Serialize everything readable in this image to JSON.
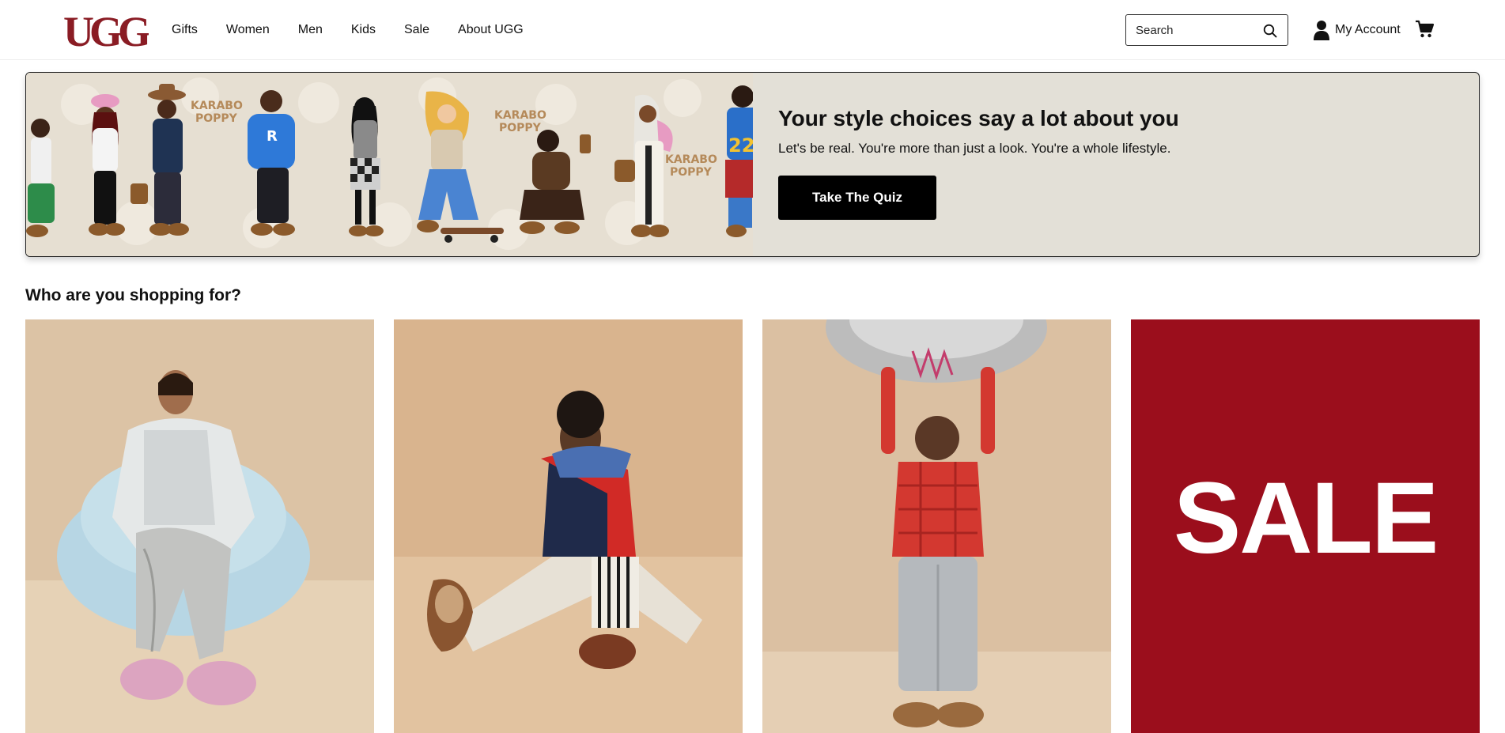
{
  "brand": {
    "logo_text": "UGG",
    "color": "#8a1c24"
  },
  "nav": {
    "items": [
      {
        "label": "Gifts"
      },
      {
        "label": "Women"
      },
      {
        "label": "Men"
      },
      {
        "label": "Kids"
      },
      {
        "label": "Sale"
      },
      {
        "label": "About UGG"
      }
    ]
  },
  "search": {
    "placeholder": "Search",
    "icon": "search-icon"
  },
  "account": {
    "label": "My Account",
    "icon": "user-icon"
  },
  "cart": {
    "icon": "cart-icon"
  },
  "banner": {
    "title": "Your style choices say a lot about you",
    "subtitle": "Let's be real. You're more than just a look. You're a whole lifestyle.",
    "button_label": "Take The Quiz",
    "art_lettering": [
      "KARABO",
      "POPPY"
    ],
    "background_color": "#e3e0d7"
  },
  "shopping": {
    "heading": "Who are you shopping for?",
    "tiles": [
      {
        "category": "women",
        "image": "woman-in-silver-outfit-on-blue-chair"
      },
      {
        "category": "men",
        "image": "man-in-red-sweater-seated"
      },
      {
        "category": "kids",
        "image": "child-holding-silver-balloon"
      },
      {
        "category": "sale",
        "label": "SALE",
        "color": "#9b0e1c"
      }
    ]
  }
}
